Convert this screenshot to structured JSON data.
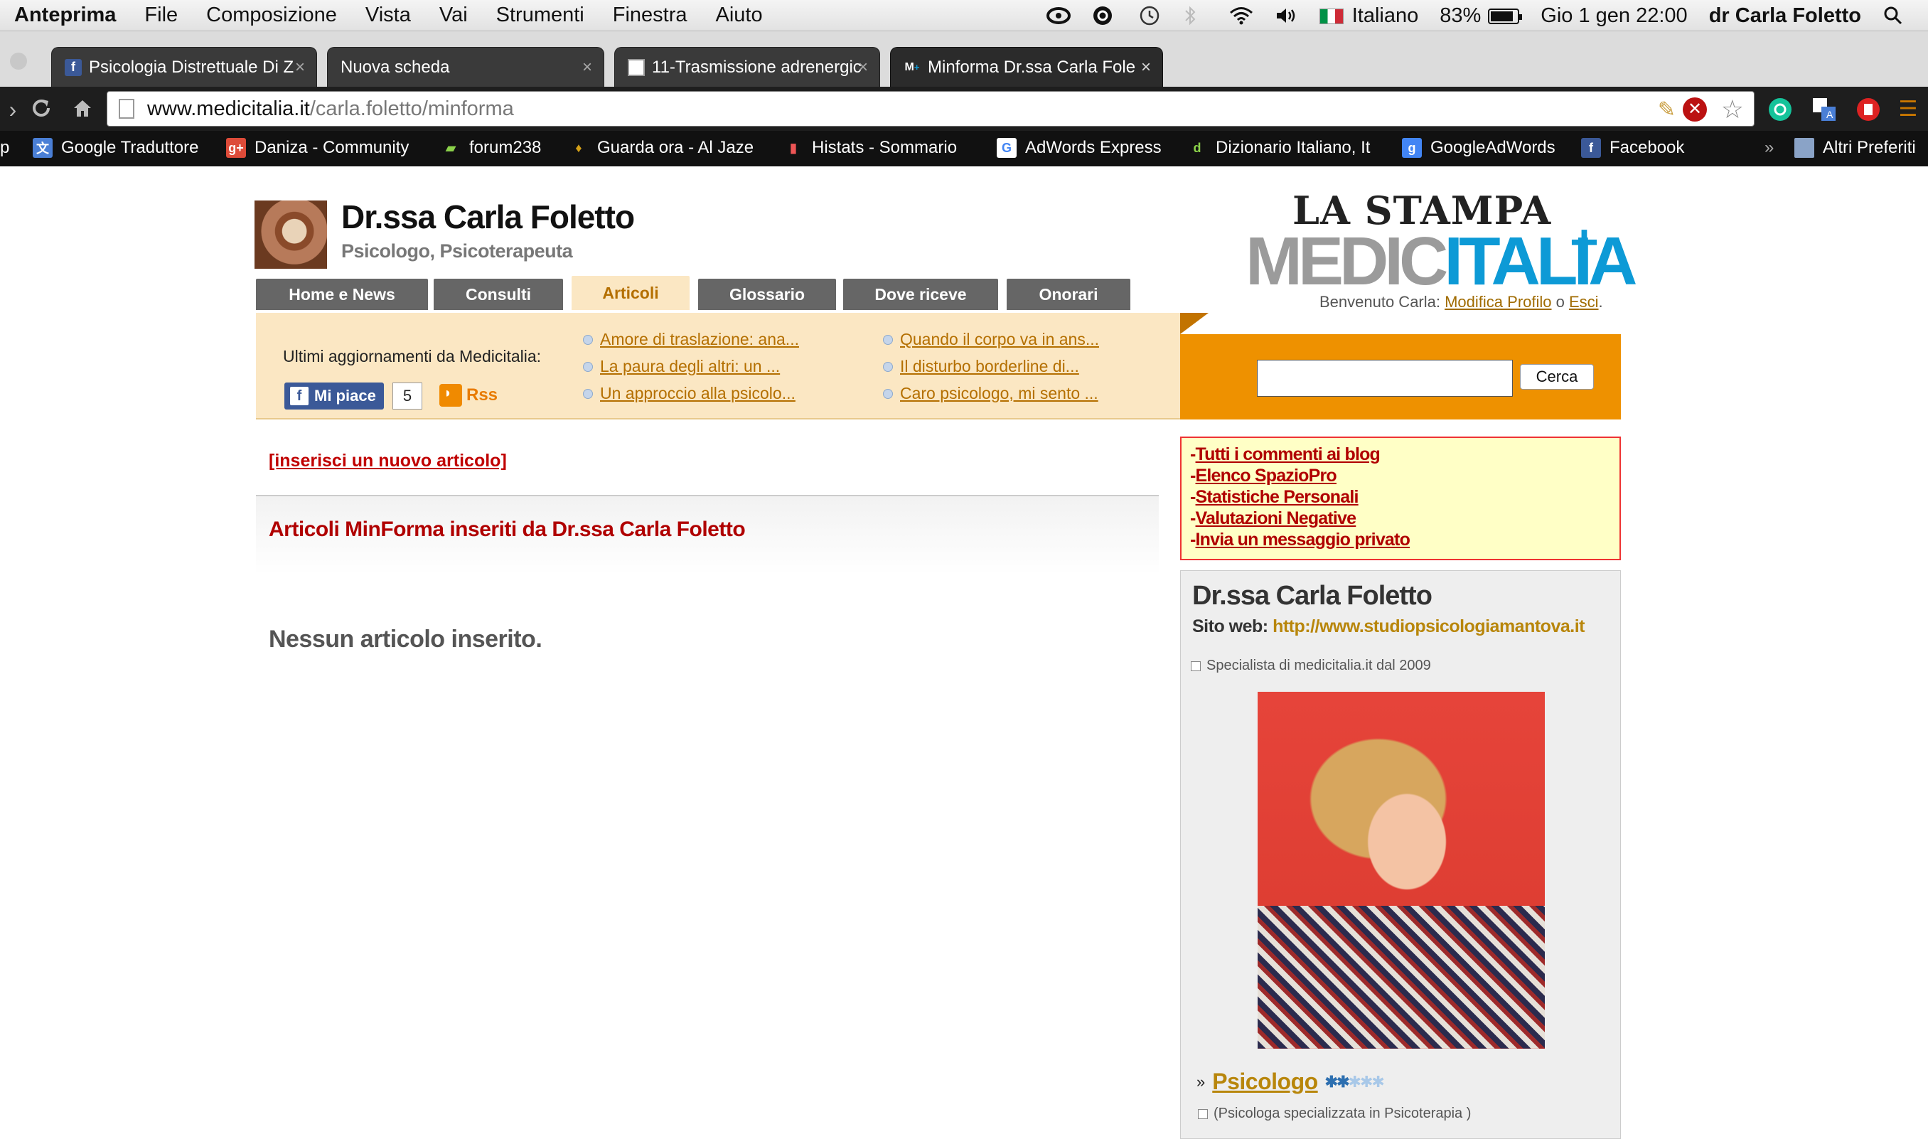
{
  "menubar": {
    "app": "Anteprima",
    "items": [
      "File",
      "Composizione",
      "Vista",
      "Vai",
      "Strumenti",
      "Finestra",
      "Aiuto"
    ],
    "language": "Italiano",
    "battery": "83%",
    "clock": "Gio 1 gen  22:00",
    "user": "dr Carla Foletto"
  },
  "tabs": [
    {
      "label": "Psicologia Distrettuale Di Z",
      "icon": "facebook-icon"
    },
    {
      "label": "Nuova scheda",
      "icon": ""
    },
    {
      "label": "11-Trasmissione adrenergic",
      "icon": "document-icon"
    },
    {
      "label": "Minforma Dr.ssa Carla Fole",
      "icon": "medicitalia-icon"
    }
  ],
  "address": {
    "host": "www.medicitalia.it",
    "path": "/carla.foletto/minforma"
  },
  "bookmarks": [
    {
      "label": "Google Traduttore",
      "color": "#4a7fd6",
      "glyph": "文"
    },
    {
      "label": "Daniza - Community",
      "color": "#dd4b39",
      "glyph": "g+"
    },
    {
      "label": "forum238",
      "color": "#111111",
      "glyph": "▰"
    },
    {
      "label": "Guarda ora - Al Jaze",
      "color": "#111111",
      "glyph": "♦"
    },
    {
      "label": "Histats - Sommario",
      "color": "#111111",
      "glyph": "▮"
    },
    {
      "label": "AdWords Express",
      "color": "#4285f4",
      "glyph": "G"
    },
    {
      "label": "Dizionario Italiano, It",
      "color": "#111111",
      "glyph": "d"
    },
    {
      "label": "GoogleAdWords",
      "color": "#4285f4",
      "glyph": "g"
    },
    {
      "label": "Facebook",
      "color": "#3b5998",
      "glyph": "f"
    }
  ],
  "bookmarks_more": "»",
  "bookmarks_other": "Altri Preferiti",
  "profile": {
    "name": "Dr.ssa Carla Foletto",
    "role": "Psicologo, Psicoterapeuta"
  },
  "nav": [
    "Home e News",
    "Consulti",
    "Articoli",
    "Glossario",
    "Dove riceve",
    "Onorari"
  ],
  "updates": {
    "label": "Ultimi aggiornamenti da Medicitalia:",
    "links_left": [
      "Amore di traslazione: ana...",
      "La paura degli altri: un ...",
      "Un approccio alla psicolo..."
    ],
    "links_right": [
      "Quando il corpo va in ans...",
      "Il disturbo borderline di...",
      "Caro psicologo, mi sento ..."
    ],
    "like_label": "Mi piace",
    "like_count": "5",
    "rss_label": "Rss"
  },
  "logo": {
    "line1": "LA STAMPA",
    "medic": "MEDIC",
    "italia": "ITALIA",
    "plus": "+"
  },
  "welcome": {
    "prefix": "Benvenuto Carla: ",
    "edit": "Modifica Profilo",
    "middle": " o ",
    "logout": "Esci",
    "suffix": "."
  },
  "search": {
    "button": "Cerca",
    "value": ""
  },
  "main": {
    "new_article": "[inserisci un nuovo articolo]",
    "section_title": "Articoli MinForma inseriti da Dr.ssa Carla Foletto",
    "empty": "Nessun articolo inserito."
  },
  "sidebar_links": [
    "Tutti i commenti ai blog",
    "Elenco SpazioPro",
    "Statistiche Personali",
    "Valutazioni Negative",
    "Invia un messaggio privato"
  ],
  "card": {
    "name": "Dr.ssa Carla Foletto",
    "web_label": "Sito web: ",
    "web_url": "http://www.studiopsicologiamantova.it",
    "since": "Specialista di medicitalia.it dal 2009",
    "profession_prefix": "»",
    "profession": "Psicologo",
    "rating_filled": 2,
    "rating_total": 5,
    "specialization": "(Psicologa specializzata in Psicoterapia )"
  }
}
